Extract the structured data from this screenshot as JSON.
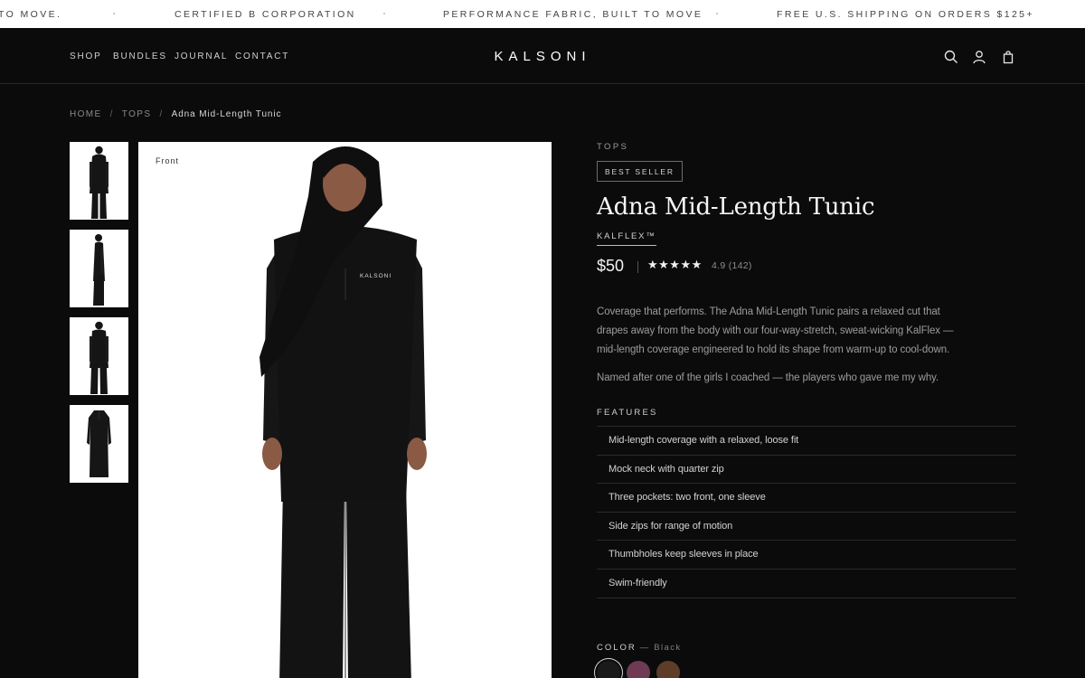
{
  "announcement": {
    "items": [
      "TO MOVE.",
      "CERTIFIED B CORPORATION",
      "PERFORMANCE FABRIC, BUILT TO MOVE",
      "FREE U.S. SHIPPING ON ORDERS $125+"
    ]
  },
  "header": {
    "logo": "KALSONI",
    "nav": [
      "SHOP",
      "BUNDLES",
      "JOURNAL",
      "CONTACT"
    ],
    "icons": [
      "search-icon",
      "account-icon",
      "cart-icon"
    ]
  },
  "breadcrumb": {
    "items": [
      "HOME",
      "TOPS",
      "Adna Mid-Length Tunic"
    ],
    "separator": "/"
  },
  "gallery": {
    "main_view_label": "Front",
    "logo_on_garment": "KALSONI"
  },
  "product": {
    "category": "TOPS",
    "badge": "BEST SELLER",
    "title": "Adna Mid-Length Tunic",
    "fabric": "KALFLEX™",
    "price": "$50",
    "stars": "★★★★★",
    "rating": 4.9,
    "rating_text": "4.9 (142)",
    "description": "Coverage that performs. The Adna Mid-Length Tunic pairs a relaxed cut that drapes away from the body with our four-way-stretch, sweat-wicking KalFlex — mid-length coverage engineered to hold its shape from warm-up to cool-down.",
    "note": "Named after one of the girls I coached — the players who gave me my why.",
    "features_heading": "FEATURES",
    "features": [
      "Mid-length coverage with a relaxed, loose fit",
      "Mock neck with quarter zip",
      "Three pockets: two front, one sleeve",
      "Side zips for range of motion",
      "Thumbholes keep sleeves in place",
      "Swim-friendly"
    ],
    "color_label": "COLOR",
    "color_dash": "—",
    "color_value": "Black",
    "swatches": [
      {
        "name": "Black",
        "hex": "#1a1a1a",
        "selected": true
      },
      {
        "name": "Plum",
        "hex": "#6e3a54",
        "selected": false
      },
      {
        "name": "Brown",
        "hex": "#5e3c2a",
        "selected": false
      }
    ]
  },
  "colors": {
    "background": "#0b0b0b",
    "announcement_bg": "#ffffff",
    "text": "#e8e8e8"
  }
}
